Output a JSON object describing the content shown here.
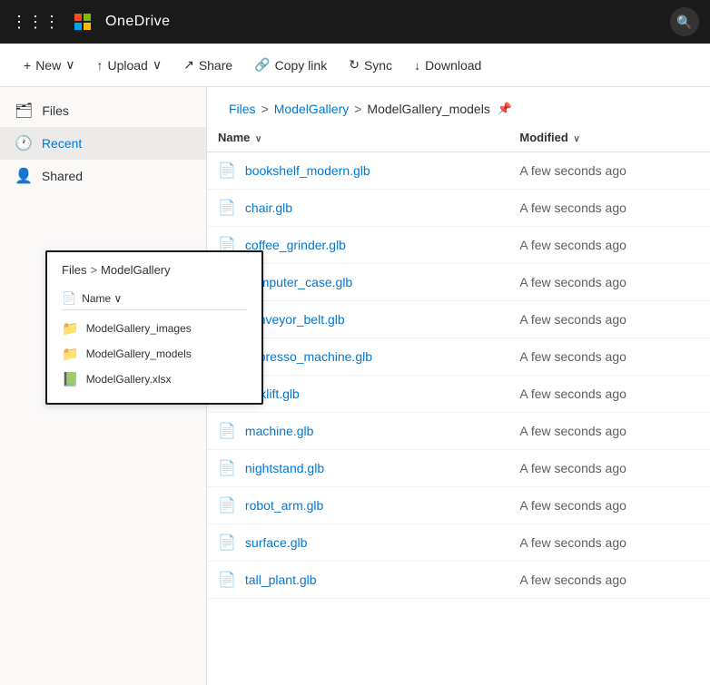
{
  "topbar": {
    "app_name": "OneDrive",
    "search_label": "Search"
  },
  "toolbar": {
    "new_label": "New",
    "upload_label": "Upload",
    "share_label": "Share",
    "copy_link_label": "Copy link",
    "sync_label": "Sync",
    "download_label": "Download"
  },
  "sidebar": {
    "items": [
      {
        "id": "files",
        "label": "Files",
        "icon": "🗂"
      },
      {
        "id": "recent",
        "label": "Recent",
        "icon": "🕐"
      },
      {
        "id": "shared",
        "label": "Shared",
        "icon": "👤"
      }
    ]
  },
  "preview": {
    "breadcrumb": {
      "files": "Files",
      "sep": ">",
      "folder": "ModelGallery"
    },
    "header_icon": "📄",
    "header_label": "Name",
    "items": [
      {
        "name": "ModelGallery_images",
        "type": "folder"
      },
      {
        "name": "ModelGallery_models",
        "type": "folder_light"
      },
      {
        "name": "ModelGallery.xlsx",
        "type": "excel"
      }
    ]
  },
  "breadcrumb": {
    "files": "Files",
    "model_gallery": "ModelGallery",
    "model_gallery_models": "ModelGallery_models"
  },
  "file_list": {
    "col_name": "Name",
    "col_modified": "Modified",
    "sort_indicator": "∨",
    "files": [
      {
        "name": "bookshelf_modern.glb",
        "modified": "A few seconds ago"
      },
      {
        "name": "chair.glb",
        "modified": "A few seconds ago"
      },
      {
        "name": "coffee_grinder.glb",
        "modified": "A few seconds ago"
      },
      {
        "name": "computer_case.glb",
        "modified": "A few seconds ago"
      },
      {
        "name": "conveyor_belt.glb",
        "modified": "A few seconds ago"
      },
      {
        "name": "espresso_machine.glb",
        "modified": "A few seconds ago"
      },
      {
        "name": "forklift.glb",
        "modified": "A few seconds ago"
      },
      {
        "name": "machine.glb",
        "modified": "A few seconds ago"
      },
      {
        "name": "nightstand.glb",
        "modified": "A few seconds ago"
      },
      {
        "name": "robot_arm.glb",
        "modified": "A few seconds ago"
      },
      {
        "name": "surface.glb",
        "modified": "A few seconds ago"
      },
      {
        "name": "tall_plant.glb",
        "modified": "A few seconds ago"
      }
    ]
  }
}
